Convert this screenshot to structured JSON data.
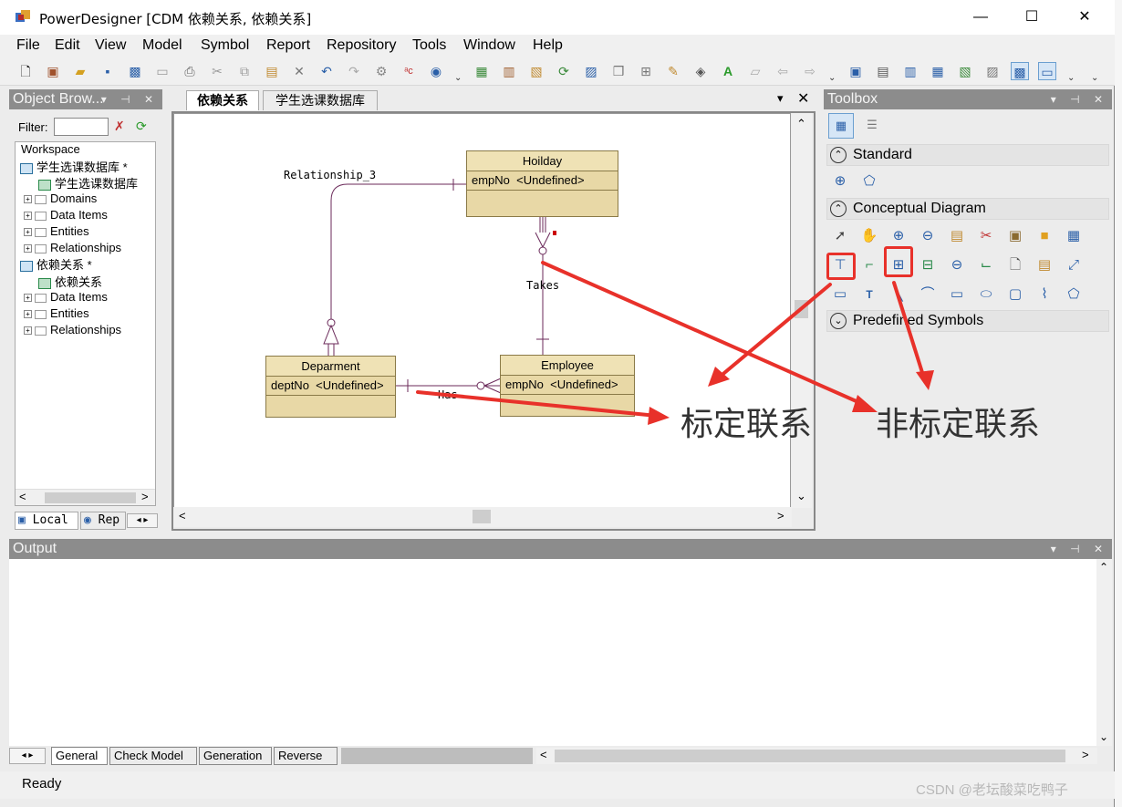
{
  "window": {
    "title": "PowerDesigner [CDM 依赖关系, 依赖关系]",
    "min": "—",
    "max": "☐",
    "close": "✕"
  },
  "menu": [
    "File",
    "Edit",
    "View",
    "Model",
    "Symbol",
    "Report",
    "Repository",
    "Tools",
    "Window",
    "Help"
  ],
  "object_browser": {
    "title": "Object Brow...",
    "filter_label": "Filter:",
    "tree": {
      "workspace": "Workspace",
      "model1": "学生选课数据库 *",
      "model1_diagram": "学生选课数据库",
      "model1_folders": [
        "Domains",
        "Data Items",
        "Entities",
        "Relationships"
      ],
      "model2": "依赖关系 *",
      "model2_diagram": "依赖关系",
      "model2_folders": [
        "Data Items",
        "Entities",
        "Relationships"
      ]
    },
    "tabs": [
      "Local",
      "Rep"
    ]
  },
  "diagram": {
    "tabs": [
      "依赖关系",
      "学生选课数据库"
    ],
    "entities": [
      {
        "name": "Hoilday",
        "attr": "empNo",
        "type": "<Undefined>"
      },
      {
        "name": "Deparment",
        "attr": "deptNo",
        "type": "<Undefined>"
      },
      {
        "name": "Employee",
        "attr": "empNo",
        "type": "<Undefined>"
      }
    ],
    "relationships": [
      "Relationship_3",
      "Takes",
      "Has"
    ]
  },
  "toolbox": {
    "title": "Toolbox",
    "groups": [
      "Standard",
      "Conceptual Diagram",
      "Predefined Symbols"
    ]
  },
  "annotations": {
    "identifying": "标定联系",
    "non_identifying": "非标定联系"
  },
  "output": {
    "title": "Output",
    "tabs": [
      "General",
      "Check Model",
      "Generation",
      "Reverse"
    ]
  },
  "status": {
    "text": "Ready",
    "watermark": "CSDN @老坛酸菜吃鸭子"
  },
  "colors": {
    "entity_fill": "#e8d8a6",
    "relationship_line": "#6b2a5a",
    "annotation_red": "#e8312a",
    "panel_header": "#8c8c8c"
  }
}
